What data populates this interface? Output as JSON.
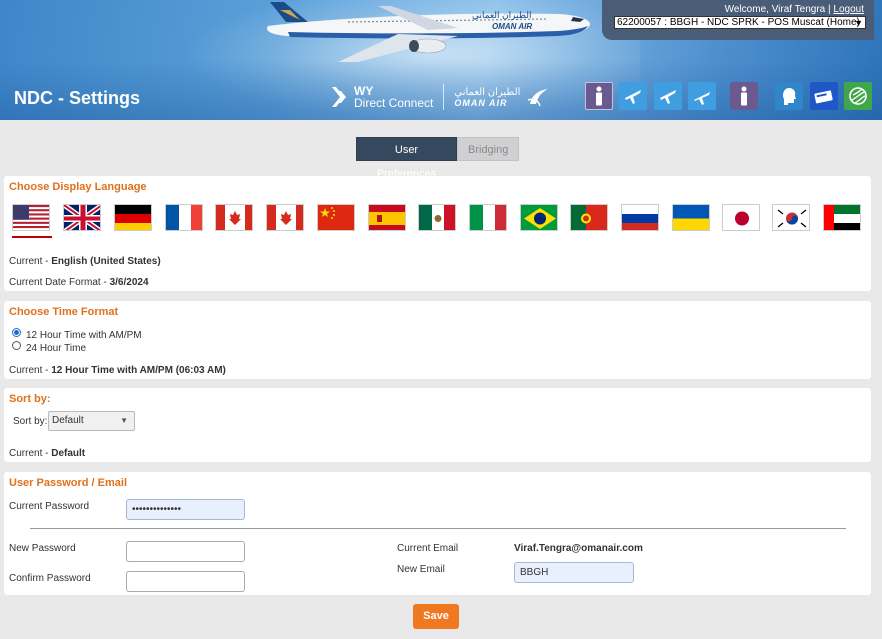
{
  "header": {
    "page_title": "NDC - Settings",
    "brand": {
      "wy": "WY",
      "direct_connect": "Direct Connect",
      "oman_air_ar": "الطيران العماني",
      "oman_air_en": "OMAN AIR"
    },
    "plane_livery": {
      "ar": "الطيران العماني",
      "en": "OMAN AIR"
    },
    "welcome_text": "Welcome, Viraf Tengra |",
    "logout_label": "Logout",
    "pos_selector_value": "62200057 : BBGH - NDC SPRK - POS Muscat (Home)"
  },
  "nav_icons": [
    "person-icon",
    "plane-icon",
    "plane-icon",
    "plane-icon",
    "person-icon",
    "head-icon",
    "ticket-icon",
    "globe-icon"
  ],
  "tabs": [
    {
      "label": "User Preferences",
      "active": true
    },
    {
      "label": "Bridging",
      "active": false
    }
  ],
  "language": {
    "title": "Choose Display Language",
    "flags": [
      "flag-us-icon",
      "flag-uk-icon",
      "flag-de-icon",
      "flag-fr-icon",
      "flag-ca-icon",
      "flag-ca-icon",
      "flag-cn-icon",
      "flag-es-icon",
      "flag-mx-icon",
      "flag-it-icon",
      "flag-br-icon",
      "flag-pt-icon",
      "flag-ru-icon",
      "flag-ua-icon",
      "flag-jp-icon",
      "flag-kr-icon",
      "flag-ae-icon"
    ],
    "current_label": "Current - ",
    "current_value": "English (United States)",
    "date_format_label": "Current Date Format - ",
    "date_format_value": "3/6/2024"
  },
  "time_format": {
    "title": "Choose Time Format",
    "options": [
      "12 Hour Time with AM/PM",
      "24 Hour Time"
    ],
    "current_label": "Current - ",
    "current_value": "12 Hour Time with AM/PM (06:03 AM)"
  },
  "sort": {
    "title": "Sort by:",
    "label": "Sort by:",
    "selected": "Default",
    "current_label": "Current - ",
    "current_value": "Default"
  },
  "account": {
    "title": "User Password / Email",
    "current_password_label": "Current Password",
    "current_password_value": "••••••••••••••",
    "new_password_label": "New Password",
    "confirm_password_label": "Confirm Password",
    "current_email_label": "Current Email",
    "current_email_value": "Viraf.Tengra@omanair.com",
    "new_email_label": "New Email",
    "new_email_value": "BBGH"
  },
  "save_label": "Save",
  "colors": {
    "accent_orange": "#f07820",
    "section_title": "#e0711a",
    "tab_active": "#34495e"
  }
}
